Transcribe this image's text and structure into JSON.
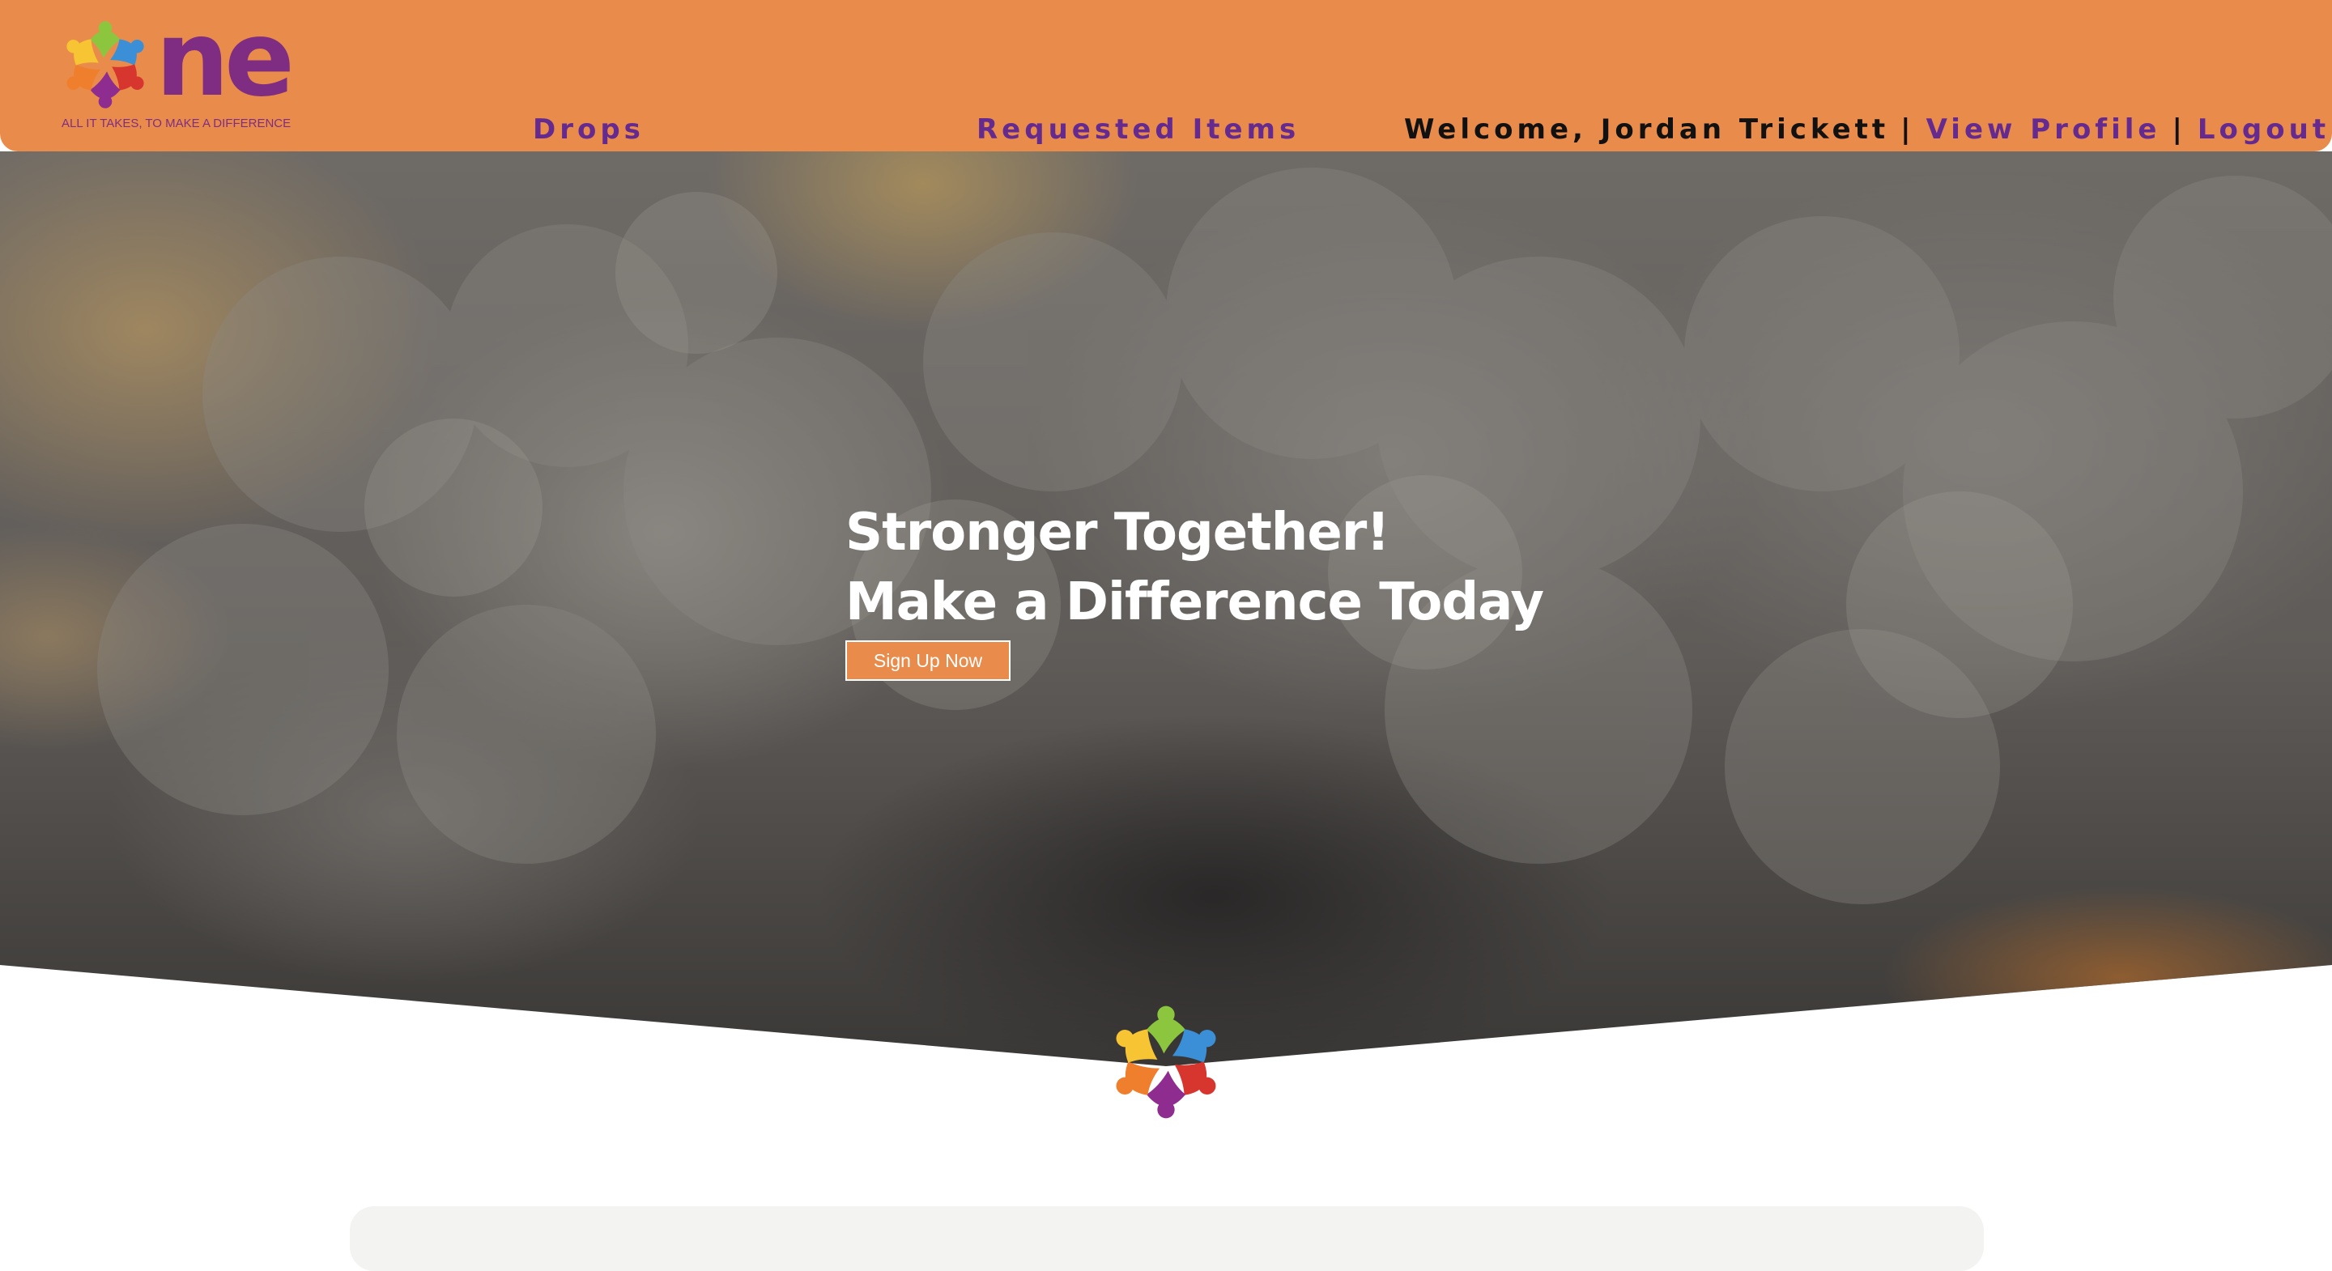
{
  "header": {
    "logo_word": "ne",
    "logo_tagline": "ALL IT TAKES, TO MAKE A DIFFERENCE",
    "nav_drops": "Drops",
    "nav_requested": "Requested Items",
    "welcome": "Welcome, Jordan Trickett",
    "separator": "|",
    "view_profile": "View Profile",
    "logout": "Logout"
  },
  "hero": {
    "line1": "Stronger Together!",
    "line2": "Make a Difference Today",
    "cta": "Sign Up Now"
  },
  "icons": {
    "logo_emblem": "people-circle-logo-icon",
    "center_emblem": "people-circle-logo-icon"
  },
  "colors": {
    "header_bg": "#e98c4b",
    "nav_purple": "#652a8f",
    "logo_purple": "#7e2d82",
    "cta_bg": "#e98c4b"
  }
}
